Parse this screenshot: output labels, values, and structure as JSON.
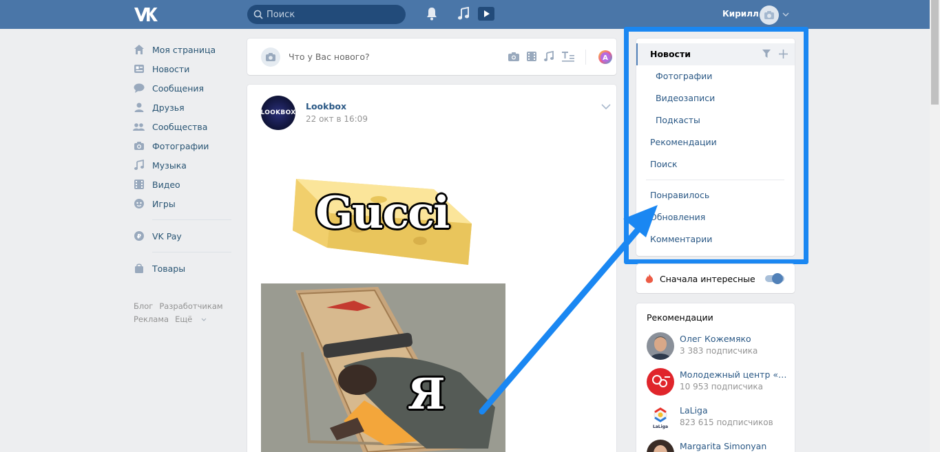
{
  "header": {
    "logo": "VK",
    "search_placeholder": "Поиск",
    "user_name": "Кирилл",
    "icons": [
      "bell-icon",
      "music-icon",
      "play-icon"
    ]
  },
  "nav": {
    "items": [
      {
        "label": "Моя страница",
        "icon": "home-icon"
      },
      {
        "label": "Новости",
        "icon": "news-icon"
      },
      {
        "label": "Сообщения",
        "icon": "messages-icon"
      },
      {
        "label": "Друзья",
        "icon": "friends-icon"
      },
      {
        "label": "Сообщества",
        "icon": "communities-icon"
      },
      {
        "label": "Фотографии",
        "icon": "camera-icon"
      },
      {
        "label": "Музыка",
        "icon": "music-icon"
      },
      {
        "label": "Видео",
        "icon": "video-icon"
      },
      {
        "label": "Игры",
        "icon": "games-icon"
      }
    ],
    "pay": {
      "label": "VK Pay",
      "icon": "vkpay-icon"
    },
    "goods": {
      "label": "Товары",
      "icon": "bag-icon"
    },
    "footer": {
      "blog": "Блог",
      "dev": "Разработчикам",
      "ads": "Реклама",
      "more": "Ещё"
    }
  },
  "composer": {
    "placeholder": "Что у Вас нового?",
    "icons": [
      "camera-icon",
      "film-icon",
      "music-icon",
      "text-icon",
      "color-palette-icon"
    ]
  },
  "post": {
    "author": "Lookbox",
    "date": "22 окт в 16:09",
    "avatar_text": "LOOKBOX",
    "image1_caption": "Gucci",
    "image2_caption": "Я"
  },
  "right_menu": {
    "active": "Новости",
    "sub_items": [
      "Фотографии",
      "Видеозаписи",
      "Подкасты"
    ],
    "items": [
      "Рекомендации",
      "Поиск"
    ],
    "items2": [
      "Понравилось",
      "Обновления",
      "Комментарии"
    ]
  },
  "toggle": {
    "label": "Сначала интересные",
    "on": true
  },
  "recommendations": {
    "title": "Рекомендации",
    "list": [
      {
        "name": "Олег Кожемяко",
        "subs": "3 383 подписчика"
      },
      {
        "name": "Молодежный центр «Ме...",
        "subs": "10 953 подписчика"
      },
      {
        "name": "LaLiga",
        "subs": "823 615 подписчиков"
      },
      {
        "name": "Margarita Simonyan",
        "subs": ""
      }
    ]
  },
  "colors": {
    "header": "#4a76a8",
    "link": "#2a5885",
    "highlight": "#1a87f2"
  }
}
